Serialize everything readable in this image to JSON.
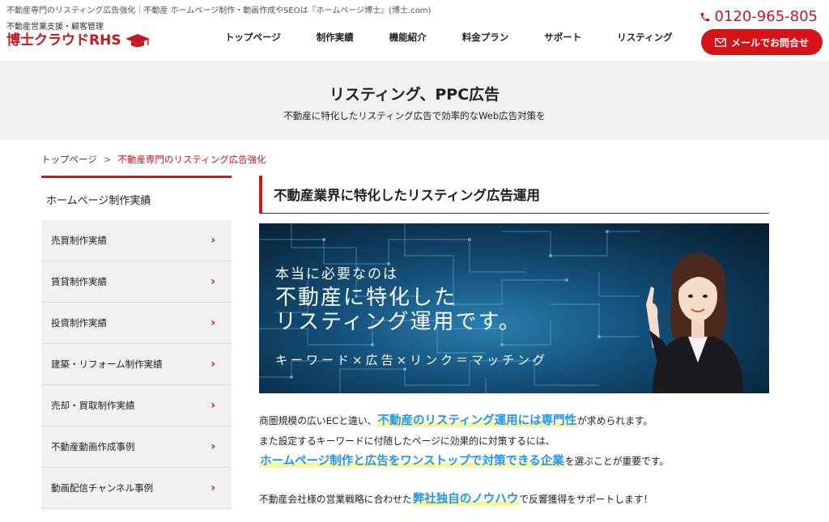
{
  "site": {
    "tagline": "不動産専門のリスティング広告強化｜不動産 ホームページ制作・動画作成やSEOは『ホームページ博士』(博士.com)",
    "logo_sub": "不動産営業支援・顧客管理",
    "logo_main": "博士クラウドRHS",
    "phone": "0120-965-805",
    "mail_button": "メールでお問合せ"
  },
  "nav": [
    {
      "label": "トップページ"
    },
    {
      "label": "制作実績"
    },
    {
      "label": "機能紹介"
    },
    {
      "label": "料金プラン"
    },
    {
      "label": "サポート"
    },
    {
      "label": "リスティング"
    }
  ],
  "hero": {
    "title": "リスティング、PPC広告",
    "subtitle": "不動産に特化したリスティング広告で効率的なWeb広告対策を"
  },
  "breadcrumb": {
    "home": "トップページ",
    "separator": ">",
    "current": "不動産専門のリスティング広告強化"
  },
  "sidebar": {
    "heading": "ホームページ制作実績",
    "items": [
      {
        "label": "売買制作実績"
      },
      {
        "label": "賃貸制作実績"
      },
      {
        "label": "投資制作実績"
      },
      {
        "label": "建築・リフォーム制作実績"
      },
      {
        "label": "売却・買取制作実績"
      },
      {
        "label": "不動産動画作成事例"
      },
      {
        "label": "動画配信チャンネル事例"
      }
    ],
    "chevron": "›"
  },
  "main": {
    "section_title": "不動産業界に特化したリスティング広告運用",
    "banner": {
      "line1": "本当に必要なのは",
      "line2": "不動産に特化した",
      "line3": "リスティング運用です。",
      "line4": "キーワード×広告×リンク＝マッチング"
    },
    "paragraph": {
      "p1_a": "商圏規模の広いECと違い、",
      "p1_hl": "不動産のリスティング運用には専門性",
      "p1_b": "が求められます。",
      "p2": "また設定するキーワードに付随したページに効果的に対策するには、",
      "p3_hl": "ホームページ制作と広告をワンストップで対策できる企業",
      "p3_b": "を選ぶことが重要です。",
      "p4_a": "不動産会社様の営業戦略に合わせた",
      "p4_hl": "弊社独自のノウハウ",
      "p4_b": "で反響獲得をサポートします！"
    }
  },
  "colors": {
    "accent": "#d7131a",
    "highlight_text": "#2196f3",
    "highlight_marker": "#fff59d",
    "band_bg": "#f2f2f2"
  },
  "icons": [
    "phone-icon",
    "mail-icon",
    "mortarboard-icon",
    "chevron-right-icon"
  ]
}
